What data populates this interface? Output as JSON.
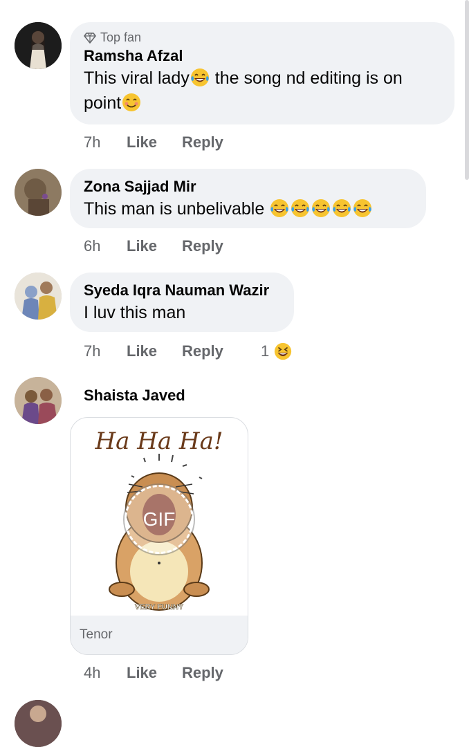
{
  "comments": [
    {
      "badge": "Top fan",
      "author": "Ramsha Afzal",
      "text_part1": "This viral lady",
      "text_part2": " the song nd editing is on point",
      "time": "7h",
      "like": "Like",
      "reply": "Reply"
    },
    {
      "author": "Zona Sajjad Mir",
      "text": "This man is unbelivable ",
      "time": "6h",
      "like": "Like",
      "reply": "Reply"
    },
    {
      "author": "Syeda Iqra Nauman Wazir",
      "text": "I luv this man",
      "time": "7h",
      "like": "Like",
      "reply": "Reply",
      "reaction_count": "1"
    },
    {
      "author": "Shaista Javed",
      "gif_title": "Ha Ha Ha!",
      "gif_caption": "VERY FUNNY",
      "gif_label": "GIF",
      "gif_source": "Tenor",
      "time": "4h",
      "like": "Like",
      "reply": "Reply"
    }
  ],
  "icons": {
    "badge": "diamond-icon",
    "emoji_tears": "tears-of-joy-emoji",
    "emoji_smile": "smiling-face-emoji",
    "emoji_squint": "laughing-squint-emoji"
  },
  "colors": {
    "bubble": "#f0f2f5",
    "meta_text": "#65676b",
    "text": "#050505"
  }
}
